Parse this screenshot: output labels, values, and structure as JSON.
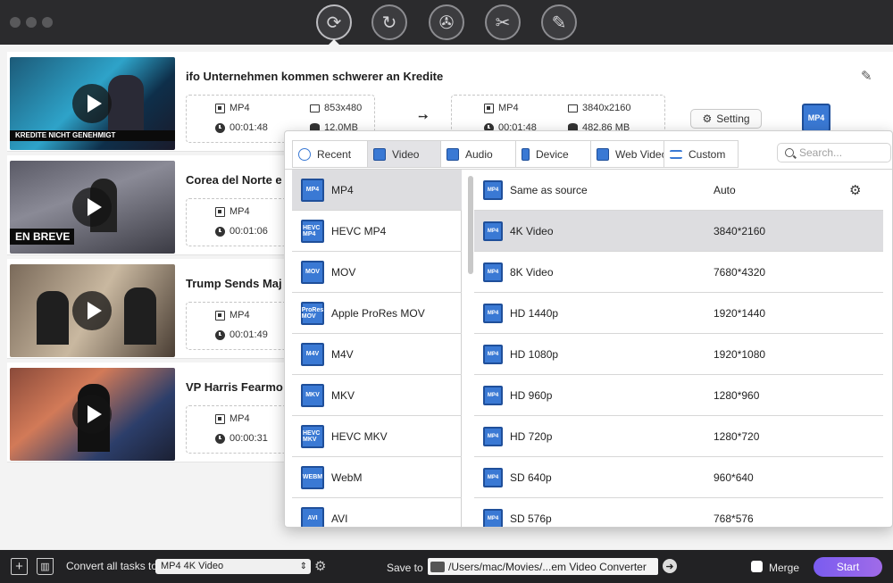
{
  "toolbar": {
    "tools": [
      {
        "icon": "convert-icon",
        "glyph": "⟳"
      },
      {
        "icon": "rotate-convert-icon",
        "glyph": "↻"
      },
      {
        "icon": "film-reel-icon",
        "glyph": "✇"
      },
      {
        "icon": "film-edit-icon",
        "glyph": "✂"
      },
      {
        "icon": "film-tools-icon",
        "glyph": "✎"
      }
    ]
  },
  "tasks": [
    {
      "title": "ifo  Unternehmen kommen schwerer an Kredite",
      "thumb_caption": "KREDITE NICHT GENEHMIGT",
      "src_format": "MP4",
      "src_duration": "00:01:48",
      "src_resolution": "853x480",
      "src_size": "12.0MB",
      "dst_format": "MP4",
      "dst_duration": "00:01:48",
      "dst_resolution": "3840x2160",
      "dst_size": "482.86 MB",
      "setting_label": "Setting",
      "badge": "MP4"
    },
    {
      "title": "Corea del Norte e",
      "thumb_caption": "EN BREVE",
      "src_format": "MP4",
      "src_duration": "00:01:06"
    },
    {
      "title": "Trump Sends Maj",
      "thumb_caption": "",
      "src_format": "MP4",
      "src_duration": "00:01:49"
    },
    {
      "title": "VP Harris Fearmo",
      "thumb_caption": "",
      "src_format": "MP4",
      "src_duration": "00:00:31"
    }
  ],
  "popup": {
    "tabs": [
      {
        "label": "Recent",
        "icon": "clock-icon"
      },
      {
        "label": "Video",
        "icon": "film-icon",
        "active": true
      },
      {
        "label": "Audio",
        "icon": "audio-icon"
      },
      {
        "label": "Device",
        "icon": "phone-icon"
      },
      {
        "label": "Web Video",
        "icon": "web-icon"
      },
      {
        "label": "Custom",
        "icon": "list-icon"
      }
    ],
    "search_placeholder": "Search...",
    "formats": [
      {
        "name": "MP4",
        "icon_text": "MP4",
        "selected": true
      },
      {
        "name": "HEVC MP4",
        "icon_text": "HEVC MP4"
      },
      {
        "name": "MOV",
        "icon_text": "MOV"
      },
      {
        "name": "Apple ProRes MOV",
        "icon_text": "ProRes MOV"
      },
      {
        "name": "M4V",
        "icon_text": "M4V"
      },
      {
        "name": "MKV",
        "icon_text": "MKV"
      },
      {
        "name": "HEVC MKV",
        "icon_text": "HEVC MKV"
      },
      {
        "name": "WebM",
        "icon_text": "WEBM"
      },
      {
        "name": "AVI",
        "icon_text": "AVI"
      }
    ],
    "presets": [
      {
        "name": "Same as source",
        "resolution": "Auto"
      },
      {
        "name": "4K Video",
        "resolution": "3840*2160",
        "selected": true
      },
      {
        "name": "8K Video",
        "resolution": "7680*4320"
      },
      {
        "name": "HD 1440p",
        "resolution": "1920*1440"
      },
      {
        "name": "HD 1080p",
        "resolution": "1920*1080"
      },
      {
        "name": "HD 960p",
        "resolution": "1280*960"
      },
      {
        "name": "HD 720p",
        "resolution": "1280*720"
      },
      {
        "name": "SD 640p",
        "resolution": "960*640"
      },
      {
        "name": "SD 576p",
        "resolution": "768*576"
      }
    ],
    "preset_icon_text": "MP4"
  },
  "bottom": {
    "convert_all_label": "Convert all tasks to",
    "convert_all_value": "MP4 4K Video",
    "save_to_label": "Save to",
    "save_path": "/Users/mac/Movies/...em Video Converter",
    "merge_label": "Merge",
    "start_label": "Start"
  },
  "colors": {
    "accent": "#3a79d4",
    "start_gradient_from": "#7a5cf0",
    "start_gradient_to": "#a06be8"
  }
}
